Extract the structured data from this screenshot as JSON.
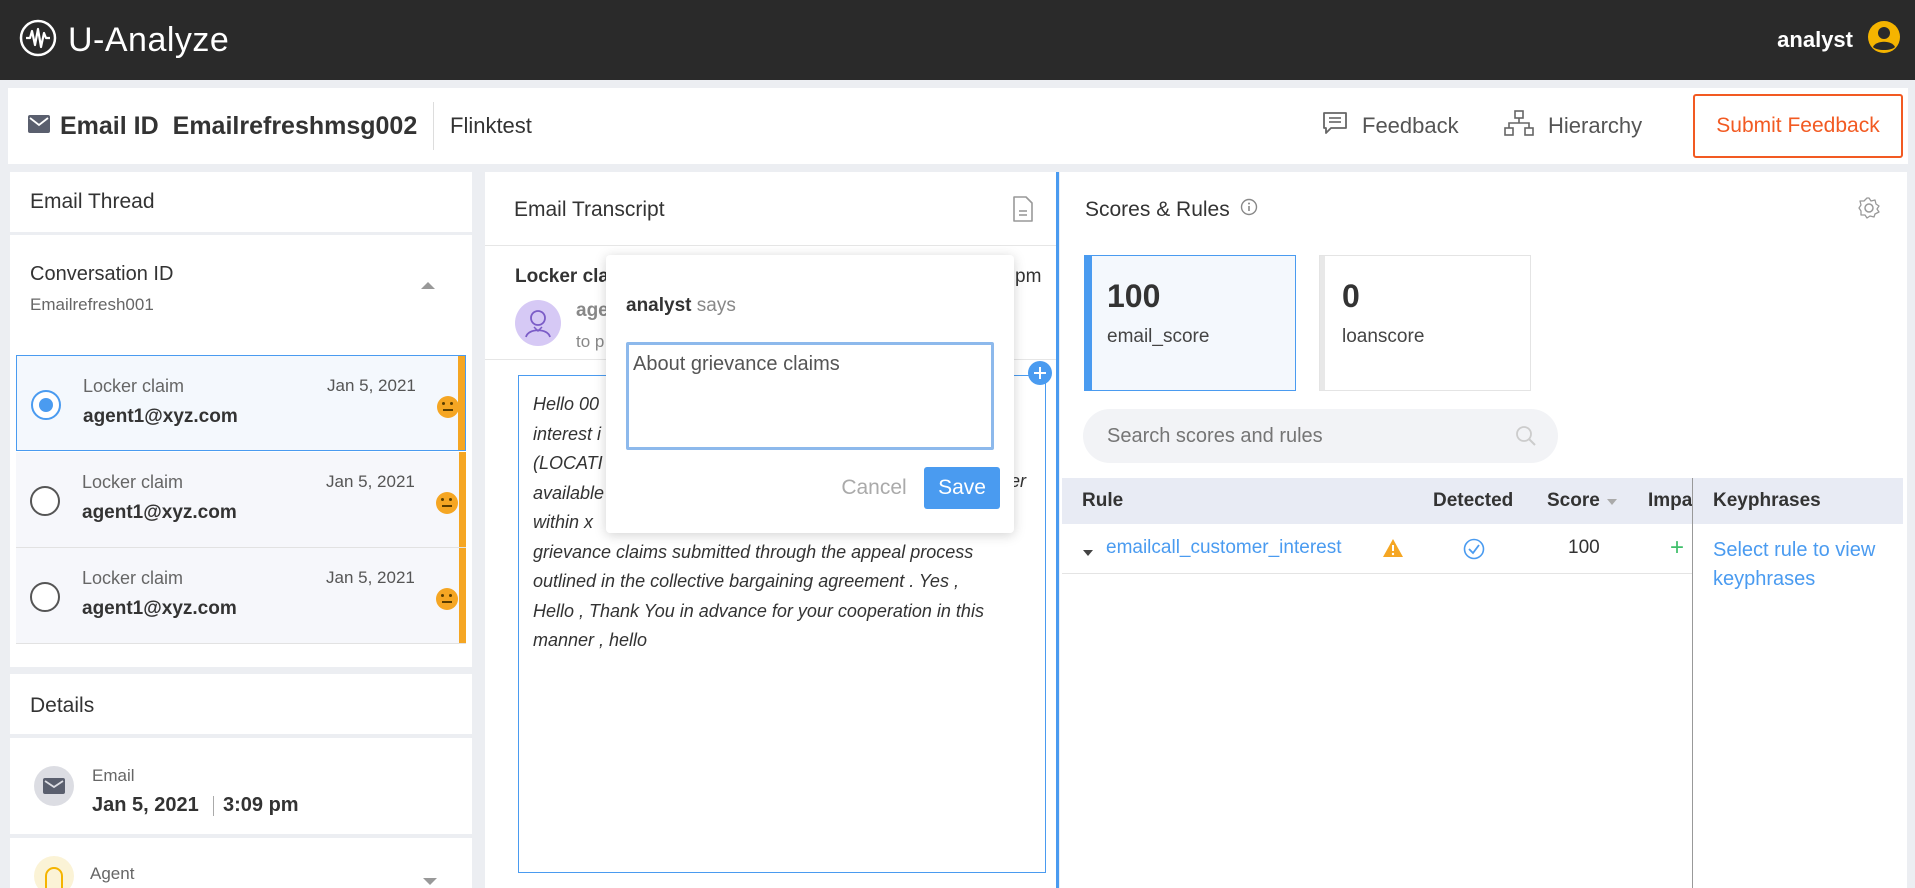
{
  "app": {
    "title": "U-Analyze",
    "user": "analyst"
  },
  "header": {
    "email_id_label": "Email ID",
    "email_id": "Emailrefreshmsg002",
    "subtitle": "Flinktest",
    "feedback_label": "Feedback",
    "hierarchy_label": "Hierarchy",
    "submit_label": "Submit Feedback"
  },
  "thread": {
    "title": "Email Thread",
    "conversation_label": "Conversation ID",
    "conversation_id": "Emailrefresh001",
    "items": [
      {
        "subject": "Locker claim",
        "date": "Jan 5, 2021",
        "from": "agent1@xyz.com",
        "selected": true
      },
      {
        "subject": "Locker claim",
        "date": "Jan 5, 2021",
        "from": "agent1@xyz.com",
        "selected": false
      },
      {
        "subject": "Locker claim",
        "date": "Jan 5, 2021",
        "from": "agent1@xyz.com",
        "selected": false
      }
    ]
  },
  "details": {
    "title": "Details",
    "email_label": "Email",
    "email_date": "Jan 5, 2021",
    "email_time": "3:09 pm",
    "agent_label": "Agent"
  },
  "transcript": {
    "title": "Email Transcript",
    "subject_partial": "Locker cla",
    "time_partial": "pm",
    "from_partial": "age",
    "to_partial": "to p",
    "lines": [
      "Hello 00",
      "interest i",
      "(LOCATI",
      "available",
      "within x",
      "grievance claims submitted through the appeal process",
      "outlined in the collective bargaining agreement . Yes ,",
      "Hello , Thank You in advance for your cooperation in this",
      "manner , hello"
    ],
    "line4_tail": "er"
  },
  "popup": {
    "author": "analyst",
    "says": "says",
    "text": "About grievance claims",
    "cancel_label": "Cancel",
    "save_label": "Save"
  },
  "scores": {
    "title": "Scores & Rules",
    "cards": [
      {
        "value": "100",
        "name": "email_score",
        "selected": true
      },
      {
        "value": "0",
        "name": "loanscore",
        "selected": false
      }
    ],
    "search_placeholder": "Search scores and rules",
    "columns": {
      "rule": "Rule",
      "detected": "Detected",
      "score": "Score",
      "impact": "Impa",
      "keyphrases": "Keyphrases"
    },
    "rows": [
      {
        "rule": "emailcall_customer_interest",
        "score": "100",
        "impact": "+"
      }
    ],
    "keyphrases_hint": "Select rule to view keyphrases"
  },
  "colors": {
    "accent": "#4a9bf0",
    "warning": "#f5a623",
    "submit": "#f25a22",
    "topbar": "#2a2a2a"
  }
}
